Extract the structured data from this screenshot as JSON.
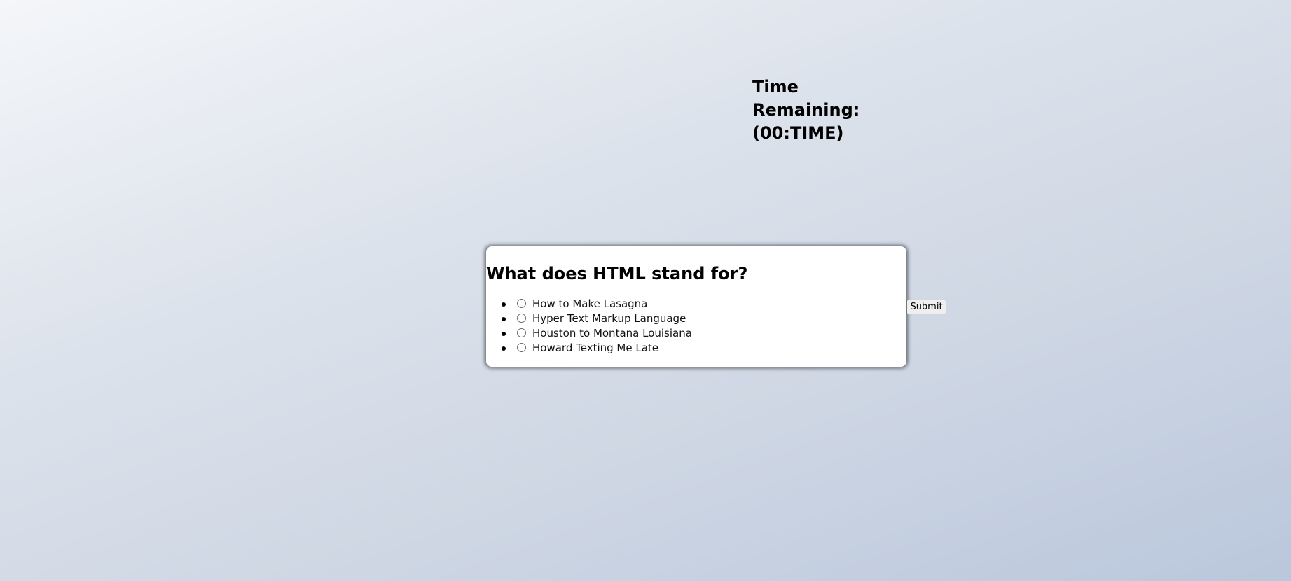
{
  "timer": {
    "line1": "Time Remaining:",
    "line2": "(00:TIME)"
  },
  "quiz": {
    "question": "What does HTML stand for?",
    "answers": [
      {
        "label": "How to Make Lasagna"
      },
      {
        "label": "Hyper Text Markup Language"
      },
      {
        "label": "Houston to Montana Louisiana"
      },
      {
        "label": "Howard Texting Me Late"
      }
    ],
    "submit_label": "Submit"
  },
  "colors": {
    "background_start": "#f4f6f9",
    "background_end": "#bac7dc",
    "card": "#ffffff",
    "text": "#000000"
  }
}
